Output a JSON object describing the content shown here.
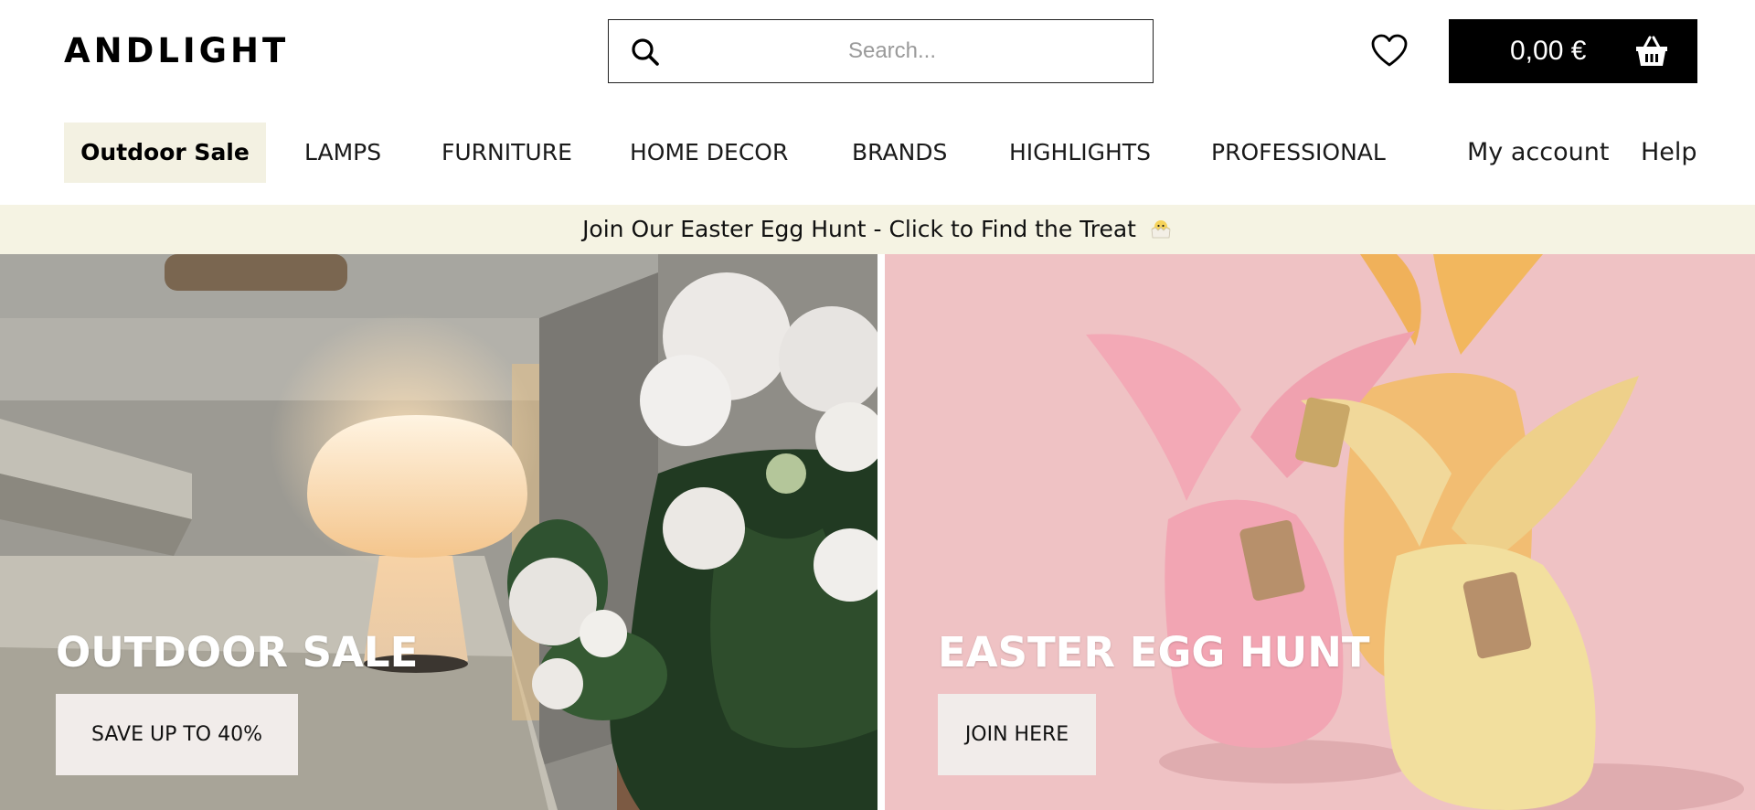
{
  "header": {
    "logo": "ANDLIGHT",
    "search_placeholder": "Search...",
    "cart_total": "0,00 €",
    "icons": {
      "search": "search-icon",
      "wishlist": "heart-icon",
      "cart": "basket-icon"
    }
  },
  "nav": {
    "sale": "Outdoor Sale",
    "items": [
      "LAMPS",
      "FURNITURE",
      "HOME DECOR",
      "BRANDS",
      "HIGHLIGHTS",
      "PROFESSIONAL"
    ],
    "account": "My account",
    "help": "Help"
  },
  "promo": {
    "text": "Join Our Easter Egg Hunt - Click to Find the Treat",
    "icon": "chick-icon"
  },
  "banners": [
    {
      "title": "OUTDOOR SALE",
      "button": "SAVE UP TO 40%"
    },
    {
      "title": "EASTER EGG HUNT",
      "button": "JOIN HERE"
    }
  ],
  "colors": {
    "accent_sale_bg": "#f3f1e2",
    "promo_bg": "#f5f3e3",
    "cart_bg": "#000000",
    "button_bg": "#f1ecea"
  }
}
